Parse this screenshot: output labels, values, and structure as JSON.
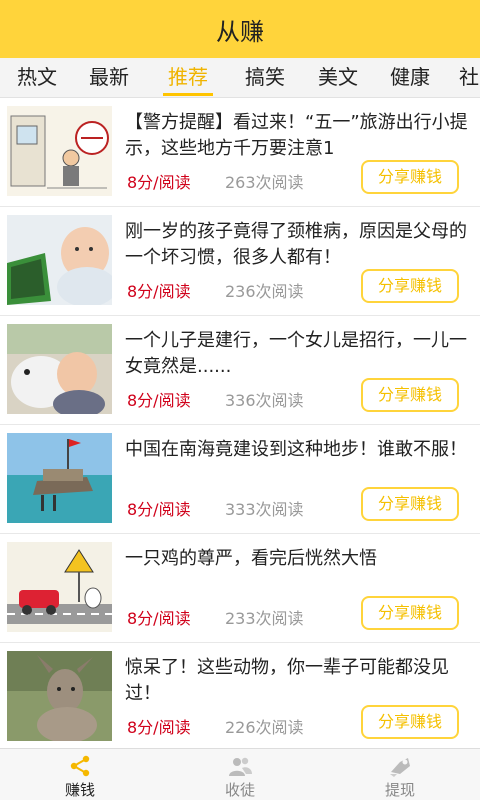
{
  "app": {
    "title": "从赚"
  },
  "tabs": [
    "热文",
    "最新",
    "推荐",
    "搞笑",
    "美文",
    "健康",
    "社"
  ],
  "articles": [
    {
      "title": "【警方提醒】看过来！“五一”旅游出行小提示，这些地方千万要注意1",
      "price": "8分/阅读",
      "reads": "263次阅读",
      "share": "分享赚钱",
      "thumb": "cartoon-police-icon"
    },
    {
      "title": "刚一岁的孩子竟得了颈椎病，原因是父母的一个坏习惯，很多人都有！",
      "price": "8分/阅读",
      "reads": "236次阅读",
      "share": "分享赚钱",
      "thumb": "baby-tablet-icon"
    },
    {
      "title": "一个儿子是建行，一个女儿是招行，一儿一女竟然是......",
      "price": "8分/阅读",
      "reads": "336次阅读",
      "share": "分享赚钱",
      "thumb": "baby-dog-icon"
    },
    {
      "title": "中国在南海竟建设到这种地步！谁敢不服！",
      "price": "8分/阅读",
      "reads": "333次阅读",
      "share": "分享赚钱",
      "thumb": "sea-island-icon"
    },
    {
      "title": "一只鸡的尊严，看完后恍然大悟",
      "price": "8分/阅读",
      "reads": "233次阅读",
      "share": "分享赚钱",
      "thumb": "chicken-cartoon-icon"
    },
    {
      "title": "惊呆了！这些动物，你一辈子可能都没见过！",
      "price": "8分/阅读",
      "reads": "226次阅读",
      "share": "分享赚钱",
      "thumb": "deer-animal-icon"
    }
  ],
  "bottom_nav": [
    {
      "label": "赚钱",
      "icon": "share-icon",
      "active": true
    },
    {
      "label": "收徒",
      "icon": "users-icon",
      "active": false
    },
    {
      "label": "提现",
      "icon": "withdraw-icon",
      "active": false
    }
  ],
  "colors": {
    "accent": "#ffd43b",
    "price": "#d0021b",
    "active_tab": "#f0b400"
  }
}
